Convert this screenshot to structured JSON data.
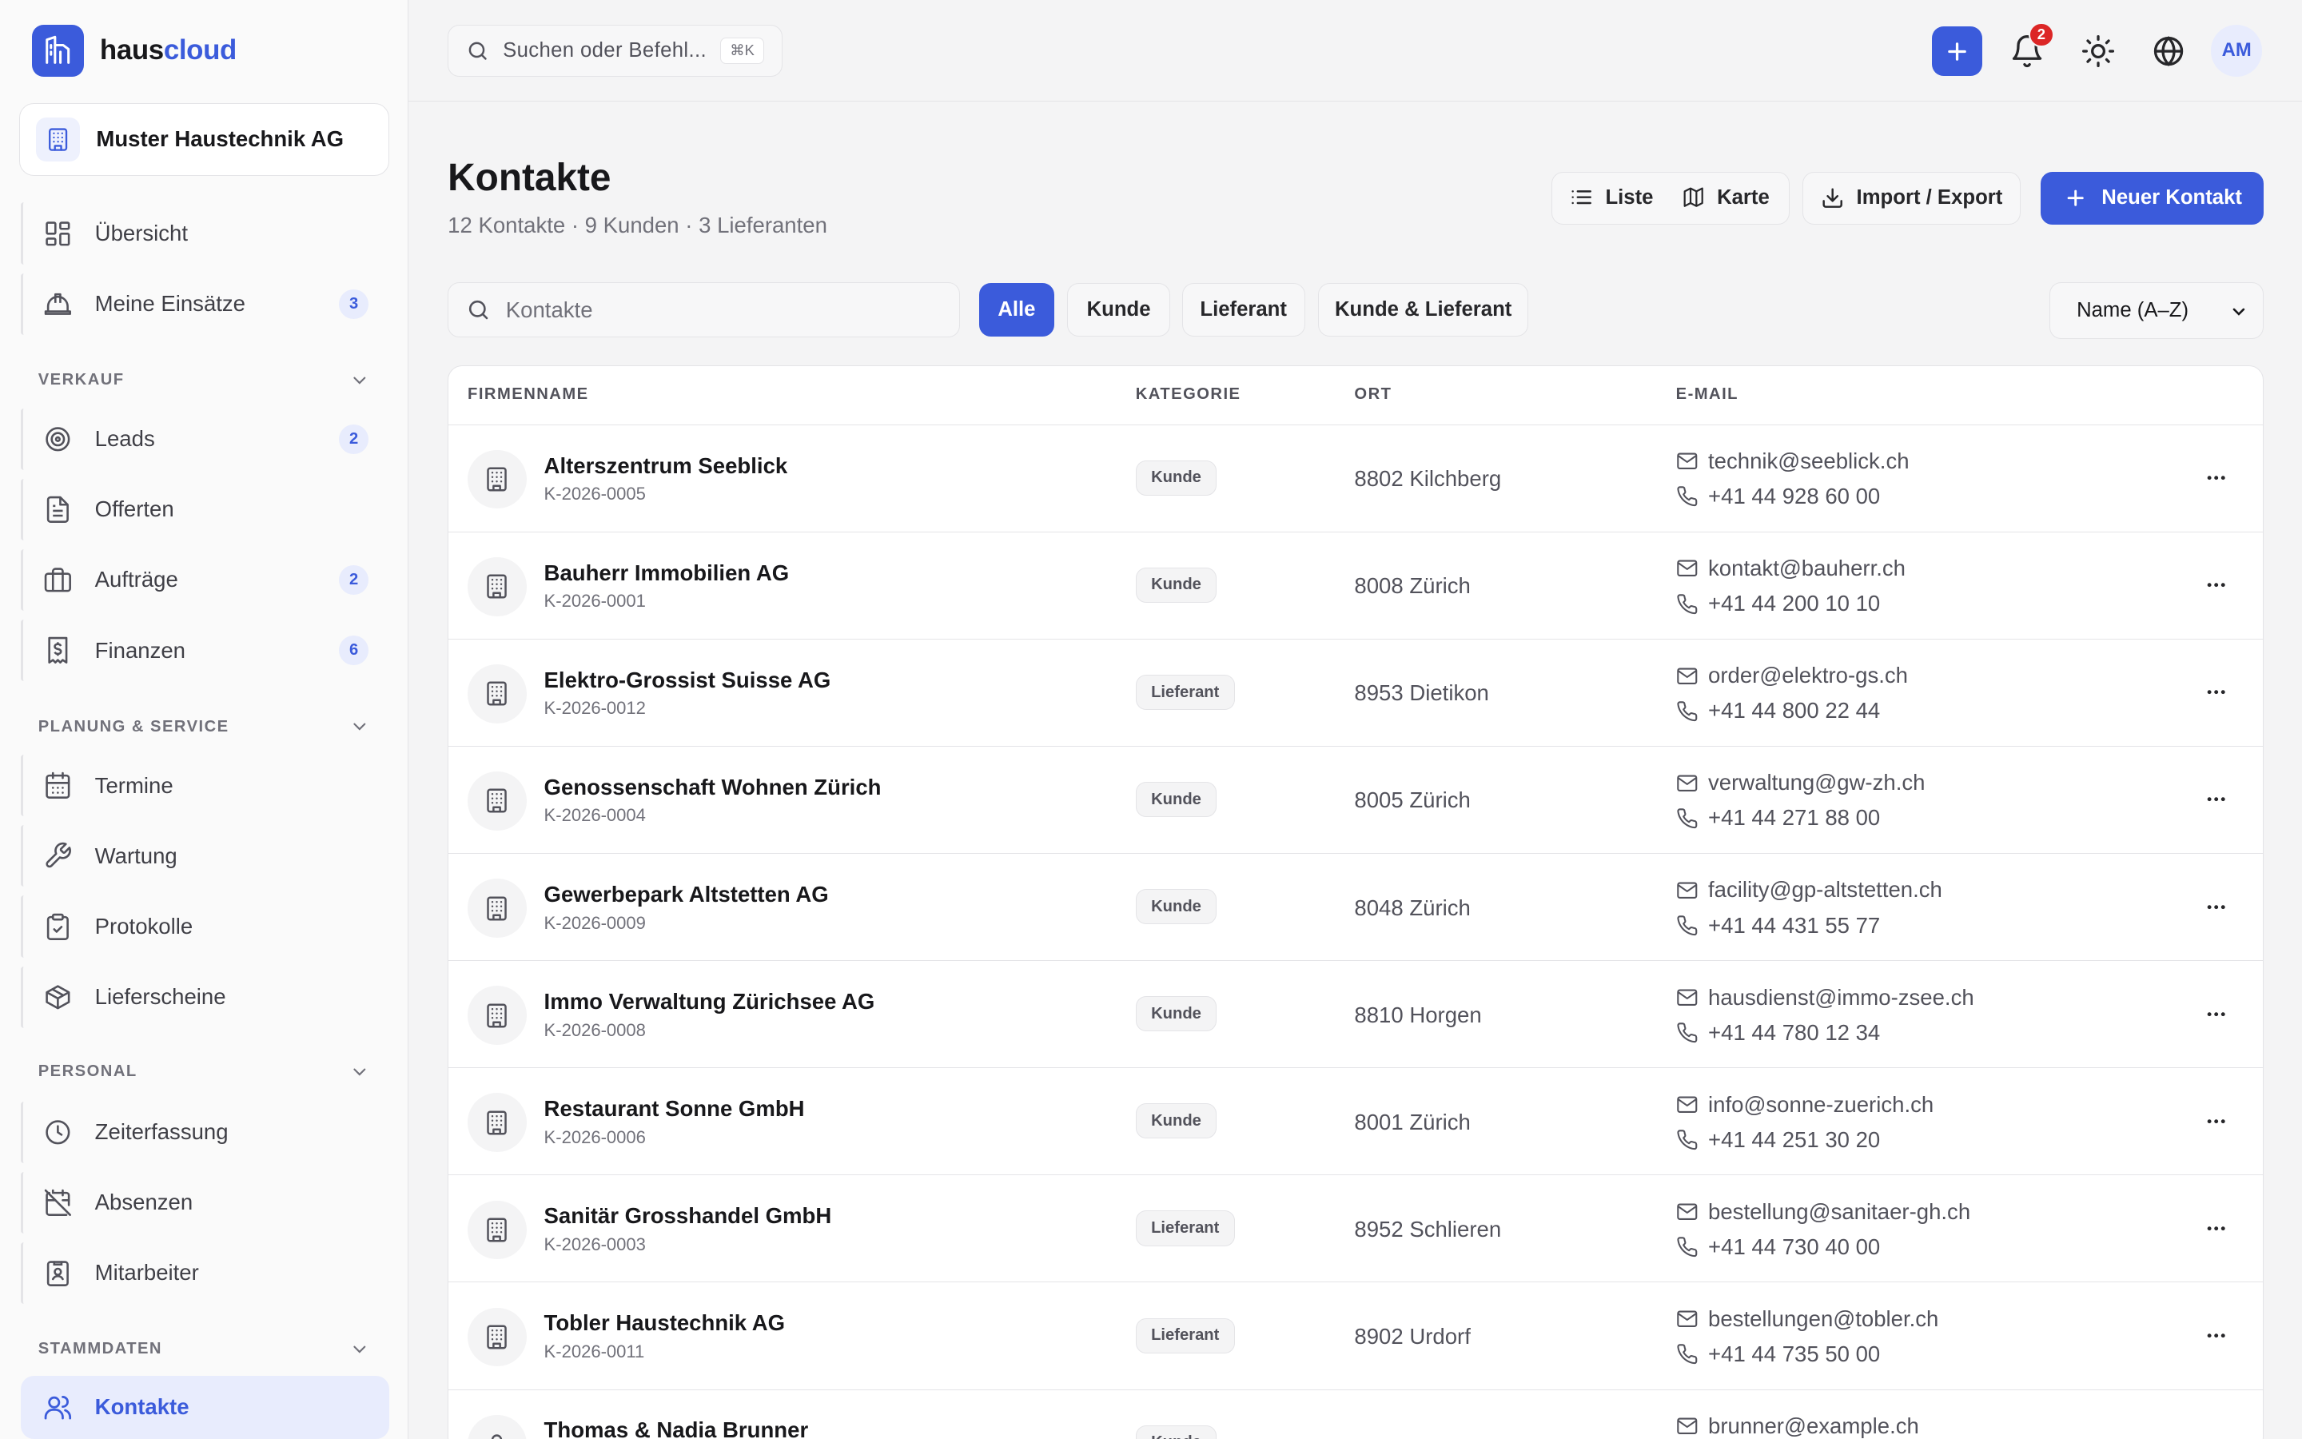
{
  "brand": {
    "name_a": "haus",
    "name_b": "cloud"
  },
  "org": {
    "name": "Muster Haustechnik AG"
  },
  "nav": {
    "uebersicht": "Übersicht",
    "einsaetze": "Meine Einsätze",
    "einsaetze_badge": "3",
    "section_verkauf": "VERKAUF",
    "leads": "Leads",
    "leads_badge": "2",
    "offerten": "Offerten",
    "auftraege": "Aufträge",
    "auftraege_badge": "2",
    "finanzen": "Finanzen",
    "finanzen_badge": "6",
    "section_planung": "PLANUNG & SERVICE",
    "termine": "Termine",
    "wartung": "Wartung",
    "protokolle": "Protokolle",
    "lieferscheine": "Lieferscheine",
    "section_personal": "PERSONAL",
    "zeiterfassung": "Zeiterfassung",
    "absenzen": "Absenzen",
    "mitarbeiter": "Mitarbeiter",
    "section_stammdaten": "STAMMDATEN",
    "kontakte": "Kontakte"
  },
  "topbar": {
    "command_placeholder": "Suchen oder Befehl...",
    "command_shortcut": "⌘K",
    "notification_count": "2",
    "avatar_initials": "AM"
  },
  "page": {
    "title": "Kontakte",
    "subtitle": "12 Kontakte · 9 Kunden · 3 Lieferanten"
  },
  "toolbar": {
    "view_list": "Liste",
    "view_map": "Karte",
    "import_export": "Import / Export",
    "new_contact": "Neuer Kontakt"
  },
  "filters": {
    "search_placeholder": "Kontakte",
    "all": "Alle",
    "customer": "Kunde",
    "supplier": "Lieferant",
    "both": "Kunde & Lieferant",
    "sort": "Name (A–Z)"
  },
  "table": {
    "columns": [
      "FIRMENNAME",
      "KATEGORIE",
      "ORT",
      "E-MAIL"
    ],
    "rows": [
      {
        "name": "Alterszentrum Seeblick",
        "id": "K-2026-0005",
        "category": "Kunde",
        "ort": "8802 Kilchberg",
        "email": "technik@seeblick.ch",
        "phone": "+41 44 928 60 00"
      },
      {
        "name": "Bauherr Immobilien AG",
        "id": "K-2026-0001",
        "category": "Kunde",
        "ort": "8008 Zürich",
        "email": "kontakt@bauherr.ch",
        "phone": "+41 44 200 10 10"
      },
      {
        "name": "Elektro-Grossist Suisse AG",
        "id": "K-2026-0012",
        "category": "Lieferant",
        "ort": "8953 Dietikon",
        "email": "order@elektro-gs.ch",
        "phone": "+41 44 800 22 44"
      },
      {
        "name": "Genossenschaft Wohnen Zürich",
        "id": "K-2026-0004",
        "category": "Kunde",
        "ort": "8005 Zürich",
        "email": "verwaltung@gw-zh.ch",
        "phone": "+41 44 271 88 00"
      },
      {
        "name": "Gewerbepark Altstetten AG",
        "id": "K-2026-0009",
        "category": "Kunde",
        "ort": "8048 Zürich",
        "email": "facility@gp-altstetten.ch",
        "phone": "+41 44 431 55 77"
      },
      {
        "name": "Immo Verwaltung Zürichsee AG",
        "id": "K-2026-0008",
        "category": "Kunde",
        "ort": "8810 Horgen",
        "email": "hausdienst@immo-zsee.ch",
        "phone": "+41 44 780 12 34"
      },
      {
        "name": "Restaurant Sonne GmbH",
        "id": "K-2026-0006",
        "category": "Kunde",
        "ort": "8001 Zürich",
        "email": "info@sonne-zuerich.ch",
        "phone": "+41 44 251 30 20"
      },
      {
        "name": "Sanitär Grosshandel GmbH",
        "id": "K-2026-0003",
        "category": "Lieferant",
        "ort": "8952 Schlieren",
        "email": "bestellung@sanitaer-gh.ch",
        "phone": "+41 44 730 40 00"
      },
      {
        "name": "Tobler Haustechnik AG",
        "id": "K-2026-0011",
        "category": "Lieferant",
        "ort": "8902 Urdorf",
        "email": "bestellungen@tobler.ch",
        "phone": "+41 44 735 50 00"
      },
      {
        "name": "Thomas & Nadia Brunner",
        "id": "",
        "category": "Kunde",
        "ort": "",
        "email": "brunner@example.ch",
        "phone": ""
      }
    ]
  }
}
